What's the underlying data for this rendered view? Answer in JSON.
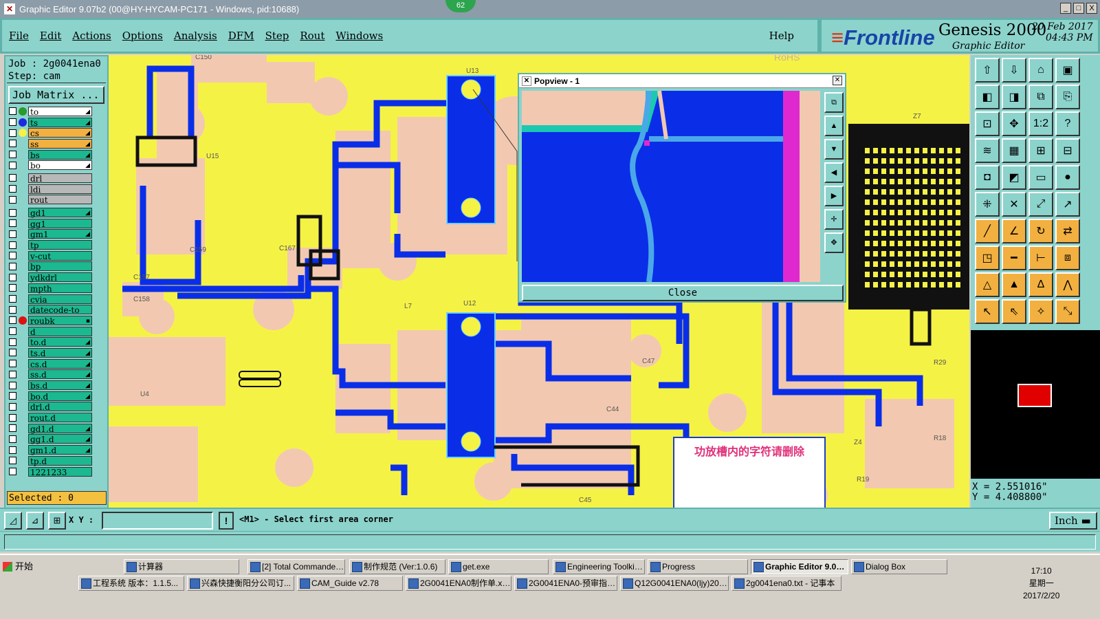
{
  "window": {
    "title": "Graphic Editor 9.07b2 (00@HY-HYCAM-PC171 - Windows, pid:10688)",
    "badge": "62",
    "controls": [
      "_",
      "□",
      "X"
    ]
  },
  "menu": {
    "items": [
      "File",
      "Edit",
      "Actions",
      "Options",
      "Analysis",
      "DFM",
      "Step",
      "Rout",
      "Windows"
    ],
    "help": "Help"
  },
  "brand": {
    "logo": "Frontline",
    "product": "Genesis 2000",
    "subtitle": "Graphic Editor",
    "date": "20 Feb 2017",
    "time": "04:43 PM"
  },
  "job": {
    "job_line": "Job : 2g0041ena0",
    "step_line": "Step: cam",
    "matrix_button": "Job Matrix ..."
  },
  "layers": [
    {
      "name": "to",
      "color": "#ffffff",
      "dot": "#2a9a2a",
      "mark": "◢"
    },
    {
      "name": "ts",
      "color": "#1cb890",
      "dot": "#1a2ae0",
      "mark": "◢"
    },
    {
      "name": "cs",
      "color": "#f2b040",
      "dot": "#f5f246",
      "mark": "◢"
    },
    {
      "name": "ss",
      "color": "#f2b040",
      "dot": "",
      "mark": "◢"
    },
    {
      "name": "bs",
      "color": "#1cb890",
      "dot": "",
      "mark": "◢"
    },
    {
      "name": "bo",
      "color": "#ffffff",
      "dot": "",
      "mark": "◢"
    },
    {
      "name": "drl",
      "color": "#b8b8b8",
      "dot": "",
      "mark": ""
    },
    {
      "name": "ldi",
      "color": "#b8b8b8",
      "dot": "",
      "mark": ""
    },
    {
      "name": "rout",
      "color": "#b8b8b8",
      "dot": "",
      "mark": ""
    },
    {
      "name": "gd1",
      "color": "#1cb890",
      "dot": "",
      "mark": "◢"
    },
    {
      "name": "gg1",
      "color": "#1cb890",
      "dot": "",
      "mark": ""
    },
    {
      "name": "gm1",
      "color": "#1cb890",
      "dot": "",
      "mark": "◢"
    },
    {
      "name": "tp",
      "color": "#1cb890",
      "dot": "",
      "mark": ""
    },
    {
      "name": "v-cut",
      "color": "#1cb890",
      "dot": "",
      "mark": ""
    },
    {
      "name": "bp",
      "color": "#1cb890",
      "dot": "",
      "mark": ""
    },
    {
      "name": "ydkdrl",
      "color": "#1cb890",
      "dot": "",
      "mark": ""
    },
    {
      "name": "mpth",
      "color": "#1cb890",
      "dot": "",
      "mark": ""
    },
    {
      "name": "cvia",
      "color": "#1cb890",
      "dot": "",
      "mark": ""
    },
    {
      "name": "datecode-to",
      "color": "#1cb890",
      "dot": "",
      "mark": ""
    },
    {
      "name": "roubk",
      "color": "#1cb890",
      "dot": "#e01010",
      "mark": "▪"
    },
    {
      "name": "d",
      "color": "#1cb890",
      "dot": "",
      "mark": ""
    },
    {
      "name": "to.d",
      "color": "#1cb890",
      "dot": "",
      "mark": "◢"
    },
    {
      "name": "ts.d",
      "color": "#1cb890",
      "dot": "",
      "mark": "◢"
    },
    {
      "name": "cs.d",
      "color": "#1cb890",
      "dot": "",
      "mark": "◢"
    },
    {
      "name": "ss.d",
      "color": "#1cb890",
      "dot": "",
      "mark": "◢"
    },
    {
      "name": "bs.d",
      "color": "#1cb890",
      "dot": "",
      "mark": "◢"
    },
    {
      "name": "bo.d",
      "color": "#1cb890",
      "dot": "",
      "mark": "◢"
    },
    {
      "name": "drl.d",
      "color": "#1cb890",
      "dot": "",
      "mark": ""
    },
    {
      "name": "rout.d",
      "color": "#1cb890",
      "dot": "",
      "mark": ""
    },
    {
      "name": "gd1.d",
      "color": "#1cb890",
      "dot": "",
      "mark": "◢"
    },
    {
      "name": "gg1.d",
      "color": "#1cb890",
      "dot": "",
      "mark": "◢"
    },
    {
      "name": "gm1.d",
      "color": "#1cb890",
      "dot": "",
      "mark": "◢"
    },
    {
      "name": "tp.d",
      "color": "#1cb890",
      "dot": "",
      "mark": ""
    },
    {
      "name": "1221233",
      "color": "#1cb890",
      "dot": "",
      "mark": ""
    }
  ],
  "selected": "Selected : 0",
  "board_labels": {
    "u13": "U13",
    "u12": "U12",
    "u15": "U15",
    "u4": "U4",
    "rohs": "RoHS",
    "c159": "C159",
    "c157": "C157",
    "c158": "C158",
    "c167": "C167",
    "c150": "C150",
    "c47": "C47",
    "c44": "C44",
    "c45": "C45",
    "r29": "R29",
    "r18": "R18",
    "r19": "R19",
    "z4": "Z4",
    "z7": "Z7",
    "l7": "L7"
  },
  "popview": {
    "title": "Popview - 1",
    "close": "Close"
  },
  "note": "功放槽内的字符请删除",
  "coords": {
    "x": "X = 2.551016\"",
    "y": "Y = 4.408800\""
  },
  "bottom": {
    "xy_label": "X Y :",
    "xy_value": "",
    "message_icon": "!",
    "message": "<M1> - Select first area corner",
    "units": "Inch"
  },
  "taskbar": {
    "start": "开始",
    "row1": [
      "计算器",
      "[2] Total Commander ...",
      "制作规范 (Ver:1.0.6)",
      "get.exe",
      "Engineering Toolkit 9....",
      "Progress",
      "Graphic Editor 9.07...",
      "Dialog Box"
    ],
    "row2": [
      "工程系统  版本：1.1.5...",
      "兴森快捷衡阳分公司订...",
      "CAM_Guide v2.78",
      "2G0041ENA0制作单.xls ...",
      "2G0041ENA0-预审指示...",
      "Q12G0041ENA0(ljy)2017...",
      "2g0041ena0.txt - 记事本"
    ],
    "time": "17:10",
    "weekday": "星期一",
    "date": "2017/2/20"
  },
  "colors": {
    "panel": "#8cd3cc",
    "board_yellow": "#f5f246",
    "trace_blue": "#0a2ee8",
    "pad_pink": "#f2c9b0"
  }
}
